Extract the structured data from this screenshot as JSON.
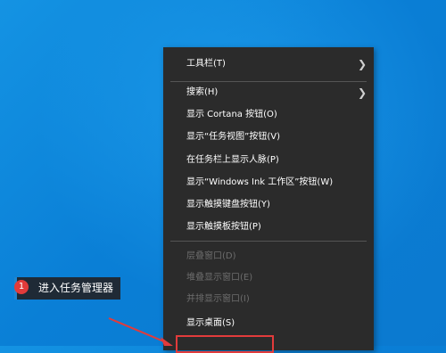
{
  "context_menu": {
    "items": [
      {
        "label": "工具栏(T)",
        "submenu": true,
        "enabled": true
      },
      {
        "label": "搜索(H)",
        "submenu": true,
        "enabled": true
      },
      {
        "label": "显示 Cortana 按钮(O)",
        "submenu": false,
        "enabled": true
      },
      {
        "label": "显示“任务视图”按钮(V)",
        "submenu": false,
        "enabled": true
      },
      {
        "label": "在任务栏上显示人脉(P)",
        "submenu": false,
        "enabled": true
      },
      {
        "label": "显示“Windows Ink 工作区”按钮(W)",
        "submenu": false,
        "enabled": true
      },
      {
        "label": "显示触摸键盘按钮(Y)",
        "submenu": false,
        "enabled": true
      },
      {
        "label": "显示触摸板按钮(P)",
        "submenu": false,
        "enabled": true
      },
      {
        "label": "层叠窗口(D)",
        "submenu": false,
        "enabled": false
      },
      {
        "label": "堆叠显示窗口(E)",
        "submenu": false,
        "enabled": false
      },
      {
        "label": "并排显示窗口(I)",
        "submenu": false,
        "enabled": false
      },
      {
        "label": "显示桌面(S)",
        "submenu": false,
        "enabled": true
      }
    ],
    "submenu_arrow": "chevron-right-icon"
  },
  "annotation": {
    "badge_number": "1",
    "text": "进入任务管理器"
  },
  "colors": {
    "desktop_blue": "#0a7fd6",
    "menu_bg": "#2b2b2b",
    "highlight_red": "#e23b3b"
  }
}
